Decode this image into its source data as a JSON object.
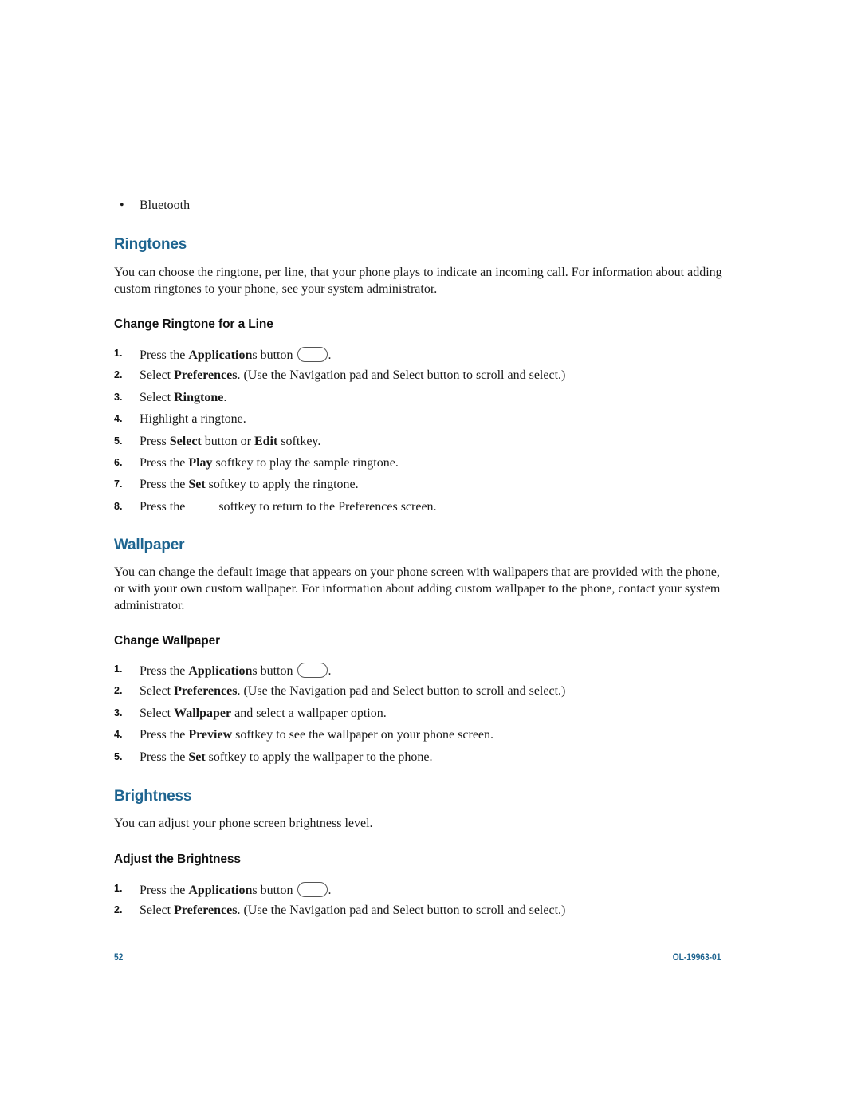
{
  "bullets": [
    "Bluetooth"
  ],
  "sections": {
    "ringtones": {
      "title": "Ringtones",
      "intro": "You can choose the ringtone, per line, that your phone plays to indicate an incoming call. For information about adding custom ringtones to your phone, see your system administrator.",
      "subheading": "Change Ringtone for a Line",
      "steps": [
        {
          "num": "1.",
          "pre": "Press the ",
          "bold": "Application",
          "post": "s button",
          "icon": "applications-button-icon",
          "tail": "."
        },
        {
          "num": "2.",
          "pre": "Select ",
          "bold": "Preferences",
          "post": ". (Use the Navigation pad and Select button to scroll and select.)"
        },
        {
          "num": "3.",
          "pre": "Select ",
          "bold": "Ringtone",
          "post": "."
        },
        {
          "num": "4.",
          "pre": "Highlight a ringtone.",
          "bold": "",
          "post": ""
        },
        {
          "num": "5.",
          "pre": "Press ",
          "bold": "Select",
          "post": " button or ",
          "bold2": "Edit",
          "post2": " softkey."
        },
        {
          "num": "6.",
          "pre": "Press the ",
          "bold": "Play",
          "post": " softkey to play the sample ringtone."
        },
        {
          "num": "7.",
          "pre": "Press the ",
          "bold": "Set",
          "post": " softkey to apply the ringtone."
        },
        {
          "num": "8.",
          "pre": "Press the",
          "bold": "",
          "post": "softkey to return to the Preferences screen."
        }
      ]
    },
    "wallpaper": {
      "title": "Wallpaper",
      "intro": "You can change the default image that appears on your phone screen with wallpapers that are provided with the phone, or with your own custom wallpaper. For information about adding custom wallpaper to the phone, contact your system administrator.",
      "subheading": "Change Wallpaper",
      "steps": [
        {
          "num": "1.",
          "pre": "Press the ",
          "bold": "Application",
          "post": "s button",
          "icon": "applications-button-icon",
          "tail": "."
        },
        {
          "num": "2.",
          "pre": "Select ",
          "bold": "Preferences",
          "post": ". (Use the Navigation pad and Select button to scroll and select.)"
        },
        {
          "num": "3.",
          "pre": "Select ",
          "bold": "Wallpaper",
          "post": " and select a wallpaper option."
        },
        {
          "num": "4.",
          "pre": "Press the ",
          "bold": "Preview",
          "post": " softkey to see the wallpaper on your phone screen."
        },
        {
          "num": "5.",
          "pre": "Press the ",
          "bold": "Set",
          "post": " softkey to apply the wallpaper to the phone."
        }
      ]
    },
    "brightness": {
      "title": "Brightness",
      "intro": "You can adjust your phone screen brightness level.",
      "subheading": "Adjust the Brightness",
      "steps": [
        {
          "num": "1.",
          "pre": "Press the ",
          "bold": "Application",
          "post": "s button",
          "icon": "applications-button-icon",
          "tail": "."
        },
        {
          "num": "2.",
          "pre": "Select ",
          "bold": "Preferences",
          "post": ". (Use the Navigation pad and Select button to scroll and select.)"
        }
      ]
    }
  },
  "footer": {
    "page_number": "52",
    "doc_id": "OL-19963-01"
  },
  "colors": {
    "heading_blue": "#1e6490",
    "text": "#1a1a1a"
  }
}
